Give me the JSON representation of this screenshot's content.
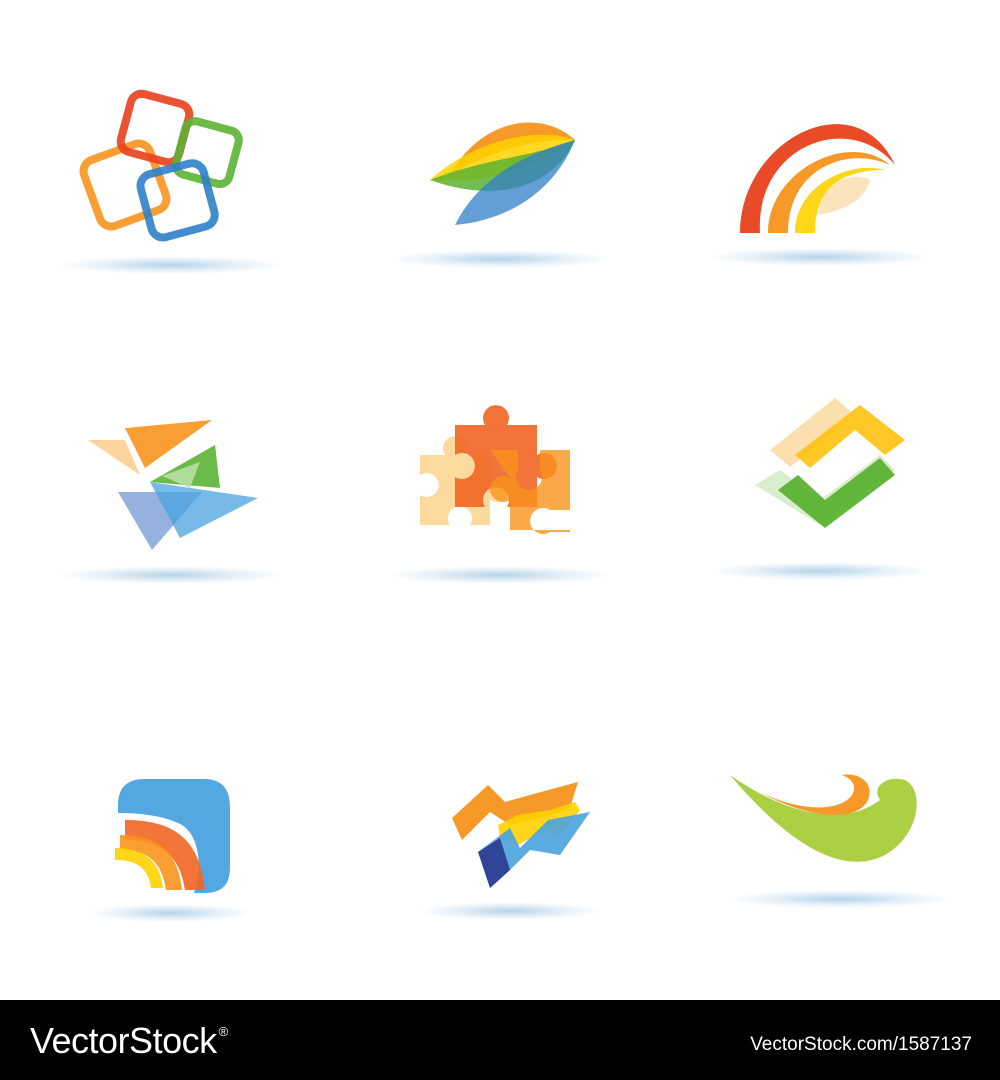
{
  "icons": [
    {
      "name": "linked-squares-icon"
    },
    {
      "name": "leaf-wing-icon"
    },
    {
      "name": "rainbow-arcs-icon"
    },
    {
      "name": "paper-planes-icon"
    },
    {
      "name": "puzzle-pieces-icon"
    },
    {
      "name": "check-mark-icon"
    },
    {
      "name": "rounded-arrow-stack-icon"
    },
    {
      "name": "zigzag-arrow-icon"
    },
    {
      "name": "swoosh-icon"
    }
  ],
  "colors": {
    "red": "#e8401c",
    "orange": "#f7941d",
    "yellow": "#ffd200",
    "green": "#5cb233",
    "lime": "#a6ce39",
    "blue": "#2f7fc8",
    "navy": "#2b3990",
    "shadow": "#9cc6e4"
  },
  "footer": {
    "brand": "VectorStock",
    "trademark": "®",
    "image_id": "VectorStock.com/1587137"
  }
}
